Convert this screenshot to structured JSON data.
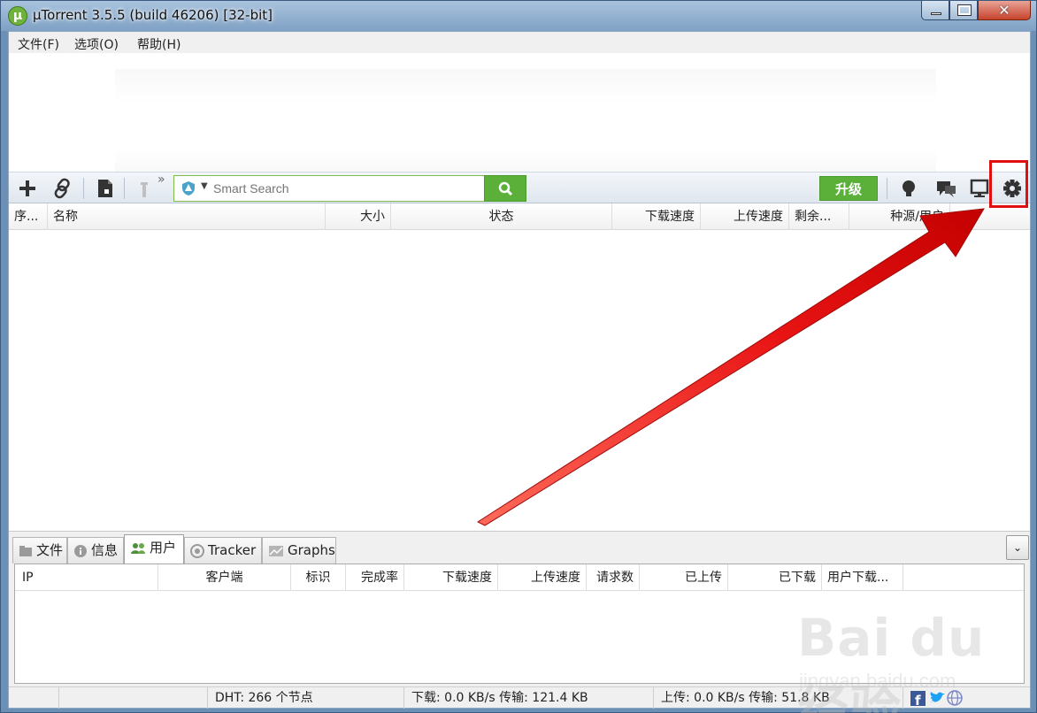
{
  "window": {
    "title": "µTorrent 3.5.5  (build 46206) [32-bit]",
    "app_icon_letter": "µ"
  },
  "menu": {
    "file": "文件(F)",
    "options": "选项(O)",
    "help": "帮助(H)"
  },
  "toolbar": {
    "search_placeholder": "Smart Search",
    "upgrade_label": "升级",
    "more_indicator": "»"
  },
  "torrent_columns": [
    "序...",
    "名称",
    "大小",
    "状态",
    "下载速度",
    "上传速度",
    "剩余...",
    "种源/用户"
  ],
  "detail_tabs": [
    {
      "label": "文件",
      "icon": "folder-icon"
    },
    {
      "label": "信息",
      "icon": "info-icon"
    },
    {
      "label": "用户",
      "icon": "users-icon"
    },
    {
      "label": "Tracker",
      "icon": "tracker-icon"
    },
    {
      "label": "Graphs",
      "icon": "graph-icon"
    }
  ],
  "active_tab": "用户",
  "peer_columns": [
    "IP",
    "客户端",
    "标识",
    "完成率",
    "下载速度",
    "上传速度",
    "请求数",
    "已上传",
    "已下载",
    "用户下载..."
  ],
  "status": {
    "dht": "DHT: 266 个节点",
    "download": "下载: 0.0 KB/s 传输: 121.4 KB",
    "upload": "上传: 0.0 KB/s 传输: 51.8 KB"
  },
  "watermark": {
    "logo": "Bai du 经验",
    "url": "jingyan.baidu.com"
  },
  "colors": {
    "accent_green": "#5bb03a",
    "annotation_red": "#e01010",
    "titlebar_blue": "#7fa1c4"
  }
}
